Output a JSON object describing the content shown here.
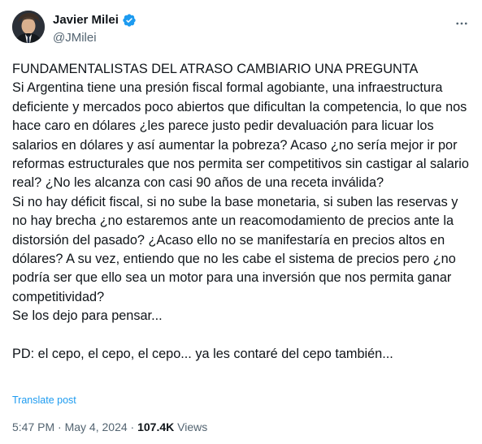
{
  "author": {
    "display_name": "Javier Milei",
    "handle": "@JMilei",
    "verified": true,
    "verified_color": "#1d9bf0"
  },
  "post": {
    "text": "FUNDAMENTALISTAS DEL ATRASO CAMBIARIO UNA PREGUNTA\nSi Argentina tiene una presión fiscal formal agobiante, una infraestructura deficiente y mercados poco abiertos que dificultan la competencia, lo que nos hace caro en dólares ¿les parece justo pedir devaluación para licuar los salarios en dólares y así aumentar la pobreza? Acaso ¿no sería mejor ir por reformas estructurales que nos permita ser competitivos sin castigar al salario real? ¿No les alcanza con casi 90 años de una receta inválida?\nSi no hay déficit fiscal, si no sube la base monetaria, si suben las reservas y no hay brecha ¿no estaremos ante un reacomodamiento de precios ante la distorsión del pasado? ¿Acaso ello no se manifestaría en precios altos en dólares? A su vez, entiendo que no les cabe el sistema de precios pero ¿no podría ser que ello sea un motor para una inversión que nos permita ganar competitividad?\nSe los dejo para pensar...\n\nPD: el cepo, el cepo, el cepo... ya les contaré del cepo también...",
    "translate_label": "Translate post",
    "time": "5:47 PM",
    "separator": "·",
    "date": "May 4, 2024",
    "views_count": "107.4K",
    "views_label": "Views"
  },
  "icons": {
    "more": "more-horizontal-icon",
    "verified": "verified-badge-icon"
  },
  "colors": {
    "link": "#1d9bf0",
    "secondary_text": "#536471",
    "primary_text": "#0f1419"
  }
}
